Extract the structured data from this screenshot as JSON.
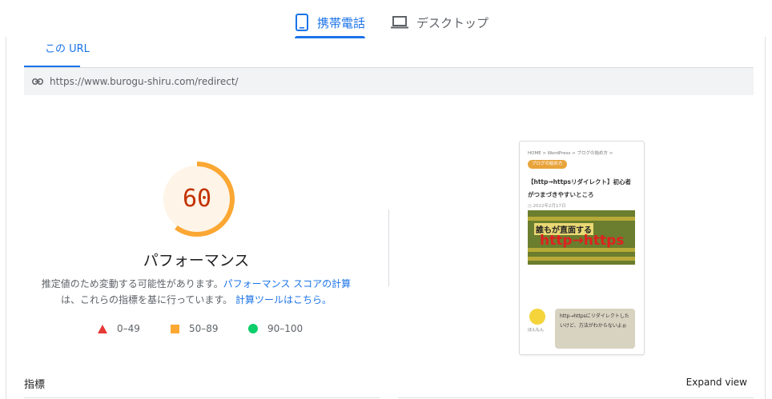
{
  "device_tabs": [
    {
      "label": "携帯電話",
      "icon": "smartphone-icon",
      "active": true
    },
    {
      "label": "デスクトップ",
      "icon": "laptop-icon",
      "active": false
    }
  ],
  "url_tab": {
    "label": "この URL"
  },
  "url": "https://www.burogu-shiru.com/redirect/",
  "score": {
    "value": "60",
    "label": "パフォーマンス",
    "fraction": 0.6,
    "color": "#fba733",
    "text_color": "#c33300"
  },
  "description": {
    "line1_prefix": "推定値のため変動する可能性があります。",
    "line1_link": "パフォーマンス スコアの計算",
    "line2_prefix": "は、これらの指標を基に行っています。",
    "line2_link": "計算ツールはこちら。"
  },
  "legend": [
    {
      "range": "0–49",
      "shape": "triangle",
      "color": "#e53935"
    },
    {
      "range": "50–89",
      "shape": "square",
      "color": "#fba733"
    },
    {
      "range": "90–100",
      "shape": "circle",
      "color": "#0cce6b"
    }
  ],
  "thumbnail": {
    "breadcrumb": "HOME > WordPress > ブログの始め方 >",
    "category": "ブログの始め方",
    "title": "【http→httpsリダイレクト】初心者がつまづきやすいところ",
    "date": "◷ 2022年2月17日",
    "hero_line1": "誰もが直面する",
    "hero_line2": "http→https",
    "author": "ぼんもん",
    "bubble": "http→httpsにリダイレクトしたいけど、方法がわからないよぉ"
  },
  "metrics_label": "指標",
  "expand_label": "Expand view"
}
